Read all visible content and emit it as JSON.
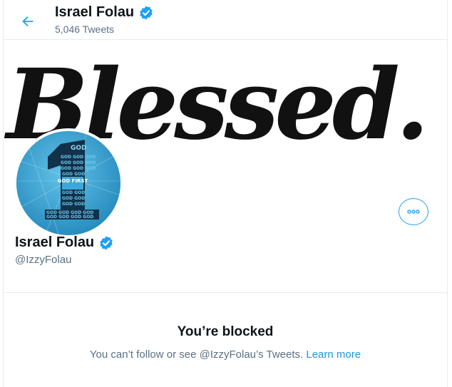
{
  "header": {
    "name": "Israel Folau",
    "tweet_count": "5,046 Tweets"
  },
  "banner": {
    "text": "Blessed."
  },
  "avatar": {
    "words_top": "GOD",
    "words_first": "GOD FIRST"
  },
  "profile": {
    "name": "Israel Folau",
    "handle": "@IzzyFolau"
  },
  "blocked": {
    "title": "You’re blocked",
    "message": "You can’t follow or see @IzzyFolau’s Tweets.",
    "link": "Learn more"
  },
  "icons": {
    "back": "arrow-left-icon",
    "verified": "verified-badge-icon",
    "more": "more-icon"
  },
  "colors": {
    "accent": "#1da1f2",
    "verified": "#1da1f2",
    "muted_text": "#5b7083",
    "avatar_bg": "#2fa0cf"
  }
}
